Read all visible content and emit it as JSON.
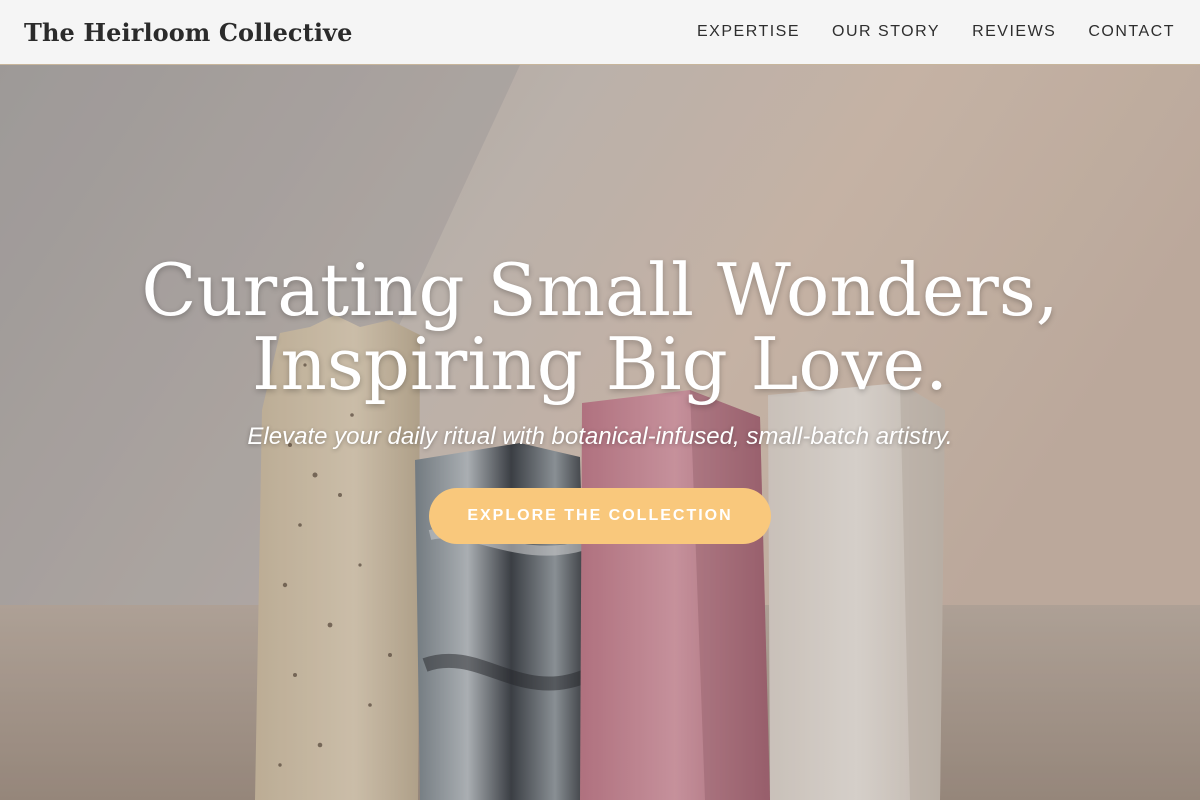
{
  "header": {
    "brand": "The Heirloom Collective",
    "nav": [
      {
        "label": "EXPERTISE"
      },
      {
        "label": "OUR STORY"
      },
      {
        "label": "REVIEWS"
      },
      {
        "label": "CONTACT"
      }
    ]
  },
  "hero": {
    "title_line1": "Curating Small Wonders,",
    "title_line2": "Inspiring Big Love.",
    "subtitle": "Elevate your daily ritual with botanical-infused, small-batch artistry.",
    "cta_label": "EXPLORE THE COLLECTION",
    "cta_color": "#f9c87c"
  },
  "colors": {
    "header_bg": "#f5f5f5",
    "header_border": "#c7b59b",
    "text_dark": "#2b2b2b"
  }
}
